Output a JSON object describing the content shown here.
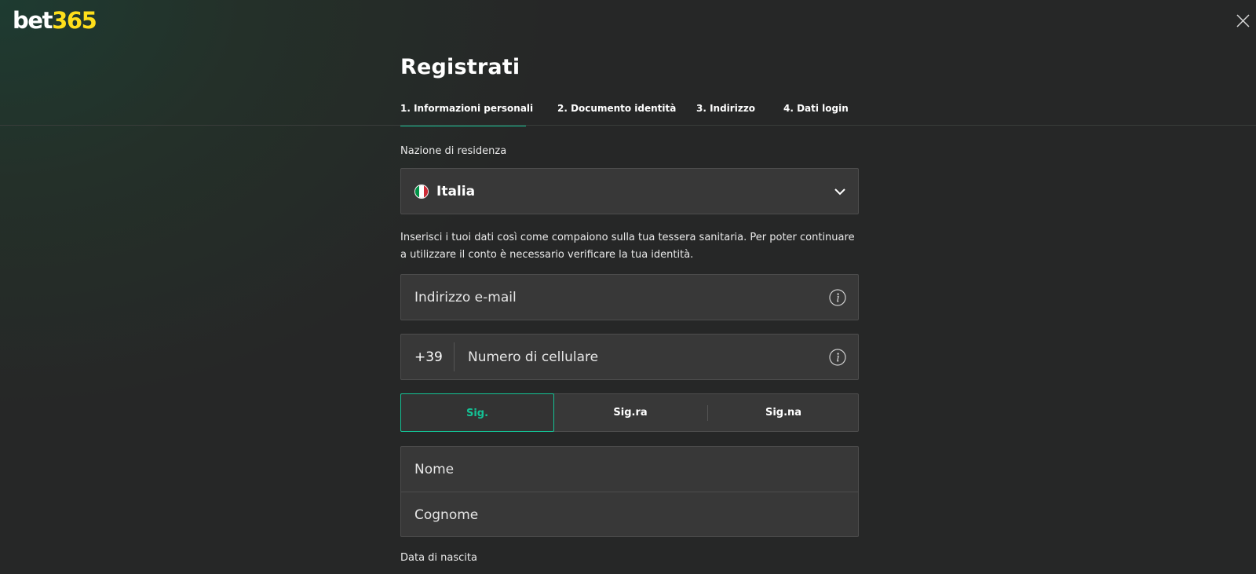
{
  "brand": {
    "logo_part1": "bet",
    "logo_part2": "365",
    "accent_yellow": "#ffdf1b"
  },
  "header": {
    "close_icon": "close-icon"
  },
  "page": {
    "title": "Registrati",
    "accent_color": "#14c295"
  },
  "tabs": [
    {
      "label": "1. Informazioni personali",
      "active": true
    },
    {
      "label": "2. Documento identità",
      "active": false
    },
    {
      "label": "3. Indirizzo",
      "active": false
    },
    {
      "label": "4. Dati login",
      "active": false
    }
  ],
  "country": {
    "label": "Nazione di residenza",
    "value": "Italia",
    "flag_icon": "italy-flag-icon",
    "flag_colors": [
      "#009246",
      "#ffffff",
      "#ce2b37"
    ],
    "chevron_icon": "chevron-down-icon"
  },
  "info_text": "Inserisci i tuoi dati così come compaiono sulla tua tessera sanitaria. Per poter continuare a utilizzare il conto è necessario verificare la tua identità.",
  "email": {
    "placeholder": "Indirizzo e-mail",
    "value": "",
    "info_icon": "info-icon"
  },
  "phone": {
    "prefix": "+39",
    "placeholder": "Numero di cellulare",
    "value": "",
    "info_icon": "info-icon"
  },
  "salutation": {
    "options": [
      "Sig.",
      "Sig.ra",
      "Sig.na"
    ],
    "selected": "Sig."
  },
  "name": {
    "first_placeholder": "Nome",
    "last_placeholder": "Cognome"
  },
  "birthdate": {
    "label": "Data di nascita"
  }
}
